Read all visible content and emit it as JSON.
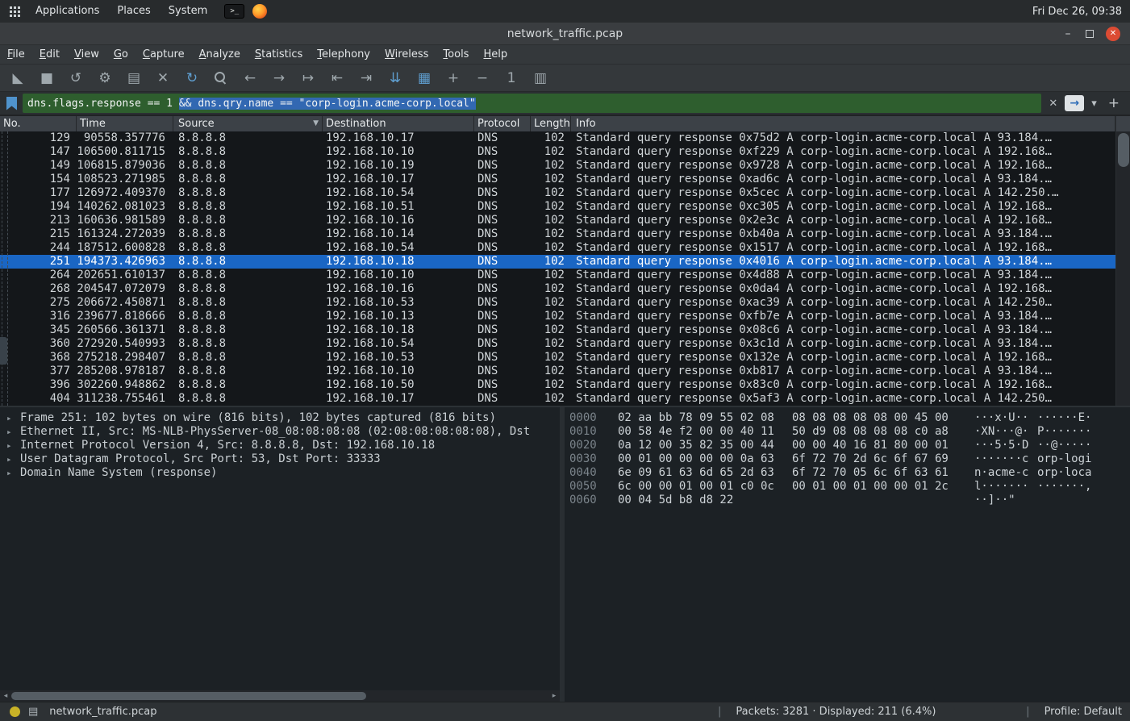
{
  "colors": {
    "filter_valid_bg": "#2e5e2e",
    "text_selection_bg": "#3268b2",
    "selected_row_bg": "#1a66c4",
    "close_button_bg": "#dc4b33",
    "accent_blue": "#5f9ecf",
    "status_dot_yellow": "#c8b227"
  },
  "desktop_bar": {
    "menus": [
      "Applications",
      "Places",
      "System"
    ],
    "terminal_glyph": ">_",
    "clock": "Fri Dec 26, 09:38"
  },
  "window": {
    "title": "network_traffic.pcap",
    "minimize_glyph": "–",
    "close_glyph": "✕"
  },
  "menu_bar": [
    "File",
    "Edit",
    "View",
    "Go",
    "Capture",
    "Analyze",
    "Statistics",
    "Telephony",
    "Wireless",
    "Tools",
    "Help"
  ],
  "toolbar": [
    {
      "name": "start-capture-icon",
      "glyph": "◣",
      "accent": false
    },
    {
      "name": "stop-capture-icon",
      "glyph": "■",
      "accent": false
    },
    {
      "name": "restart-capture-icon",
      "glyph": "↺",
      "accent": false
    },
    {
      "name": "capture-options-icon",
      "glyph": "⚙",
      "accent": false
    },
    {
      "name": "open-file-icon",
      "glyph": "▤",
      "accent": false
    },
    {
      "name": "close-file-icon",
      "glyph": "✕",
      "accent": false
    },
    {
      "name": "reload-icon",
      "glyph": "↻",
      "accent": true
    },
    {
      "name": "find-packet-icon",
      "glyph": "",
      "accent": false
    },
    {
      "name": "go-back-icon",
      "glyph": "←",
      "accent": false
    },
    {
      "name": "go-forward-icon",
      "glyph": "→",
      "accent": false
    },
    {
      "name": "go-to-packet-icon",
      "glyph": "↦",
      "accent": false
    },
    {
      "name": "go-first-icon",
      "glyph": "⇤",
      "accent": false
    },
    {
      "name": "go-last-icon",
      "glyph": "⇥",
      "accent": false
    },
    {
      "name": "auto-scroll-icon",
      "glyph": "⇊",
      "accent": true
    },
    {
      "name": "colorize-icon",
      "glyph": "▦",
      "accent": true
    },
    {
      "name": "zoom-in-icon",
      "glyph": "+",
      "accent": false
    },
    {
      "name": "zoom-out-icon",
      "glyph": "−",
      "accent": false
    },
    {
      "name": "zoom-100-icon",
      "glyph": "1",
      "accent": false
    },
    {
      "name": "resize-columns-icon",
      "glyph": "▥",
      "accent": false
    }
  ],
  "filter_bar": {
    "text_plain": "dns.flags.response == 1 ",
    "text_selected": "&& dns.qry.name == \"corp-login.acme-corp.local\"",
    "clear_glyph": "✕",
    "apply_glyph": "→",
    "dropdown_glyph": "▾",
    "add_glyph": "+"
  },
  "packet_list": {
    "columns": [
      "No.",
      "Time",
      "Source",
      "Destination",
      "Protocol",
      "Length",
      "Info"
    ],
    "column_dropdown_glyph": "▼",
    "selected_no": "251",
    "rows": [
      {
        "no": "129",
        "time": "90558.357776",
        "source": "8.8.8.8",
        "destination": "192.168.10.17",
        "protocol": "DNS",
        "length": "102",
        "info": "Standard query response 0x75d2 A corp-login.acme-corp.local A 93.184.…"
      },
      {
        "no": "147",
        "time": "106500.811715",
        "source": "8.8.8.8",
        "destination": "192.168.10.10",
        "protocol": "DNS",
        "length": "102",
        "info": "Standard query response 0xf229 A corp-login.acme-corp.local A 192.168…"
      },
      {
        "no": "149",
        "time": "106815.879036",
        "source": "8.8.8.8",
        "destination": "192.168.10.19",
        "protocol": "DNS",
        "length": "102",
        "info": "Standard query response 0x9728 A corp-login.acme-corp.local A 192.168…"
      },
      {
        "no": "154",
        "time": "108523.271985",
        "source": "8.8.8.8",
        "destination": "192.168.10.17",
        "protocol": "DNS",
        "length": "102",
        "info": "Standard query response 0xad6c A corp-login.acme-corp.local A 93.184.…"
      },
      {
        "no": "177",
        "time": "126972.409370",
        "source": "8.8.8.8",
        "destination": "192.168.10.54",
        "protocol": "DNS",
        "length": "102",
        "info": "Standard query response 0x5cec A corp-login.acme-corp.local A 142.250.…"
      },
      {
        "no": "194",
        "time": "140262.081023",
        "source": "8.8.8.8",
        "destination": "192.168.10.51",
        "protocol": "DNS",
        "length": "102",
        "info": "Standard query response 0xc305 A corp-login.acme-corp.local A 192.168…"
      },
      {
        "no": "213",
        "time": "160636.981589",
        "source": "8.8.8.8",
        "destination": "192.168.10.16",
        "protocol": "DNS",
        "length": "102",
        "info": "Standard query response 0x2e3c A corp-login.acme-corp.local A 192.168…"
      },
      {
        "no": "215",
        "time": "161324.272039",
        "source": "8.8.8.8",
        "destination": "192.168.10.14",
        "protocol": "DNS",
        "length": "102",
        "info": "Standard query response 0xb40a A corp-login.acme-corp.local A 93.184.…"
      },
      {
        "no": "244",
        "time": "187512.600828",
        "source": "8.8.8.8",
        "destination": "192.168.10.54",
        "protocol": "DNS",
        "length": "102",
        "info": "Standard query response 0x1517 A corp-login.acme-corp.local A 192.168…"
      },
      {
        "no": "251",
        "time": "194373.426963",
        "source": "8.8.8.8",
        "destination": "192.168.10.18",
        "protocol": "DNS",
        "length": "102",
        "info": "Standard query response 0x4016 A corp-login.acme-corp.local A 93.184.…"
      },
      {
        "no": "264",
        "time": "202651.610137",
        "source": "8.8.8.8",
        "destination": "192.168.10.10",
        "protocol": "DNS",
        "length": "102",
        "info": "Standard query response 0x4d88 A corp-login.acme-corp.local A 93.184.…"
      },
      {
        "no": "268",
        "time": "204547.072079",
        "source": "8.8.8.8",
        "destination": "192.168.10.16",
        "protocol": "DNS",
        "length": "102",
        "info": "Standard query response 0x0da4 A corp-login.acme-corp.local A 192.168…"
      },
      {
        "no": "275",
        "time": "206672.450871",
        "source": "8.8.8.8",
        "destination": "192.168.10.53",
        "protocol": "DNS",
        "length": "102",
        "info": "Standard query response 0xac39 A corp-login.acme-corp.local A 142.250…"
      },
      {
        "no": "316",
        "time": "239677.818666",
        "source": "8.8.8.8",
        "destination": "192.168.10.13",
        "protocol": "DNS",
        "length": "102",
        "info": "Standard query response 0xfb7e A corp-login.acme-corp.local A 93.184.…"
      },
      {
        "no": "345",
        "time": "260566.361371",
        "source": "8.8.8.8",
        "destination": "192.168.10.18",
        "protocol": "DNS",
        "length": "102",
        "info": "Standard query response 0x08c6 A corp-login.acme-corp.local A 93.184.…"
      },
      {
        "no": "360",
        "time": "272920.540993",
        "source": "8.8.8.8",
        "destination": "192.168.10.54",
        "protocol": "DNS",
        "length": "102",
        "info": "Standard query response 0x3c1d A corp-login.acme-corp.local A 93.184.…"
      },
      {
        "no": "368",
        "time": "275218.298407",
        "source": "8.8.8.8",
        "destination": "192.168.10.53",
        "protocol": "DNS",
        "length": "102",
        "info": "Standard query response 0x132e A corp-login.acme-corp.local A 192.168…"
      },
      {
        "no": "377",
        "time": "285208.978187",
        "source": "8.8.8.8",
        "destination": "192.168.10.10",
        "protocol": "DNS",
        "length": "102",
        "info": "Standard query response 0xb817 A corp-login.acme-corp.local A 93.184.…"
      },
      {
        "no": "396",
        "time": "302260.948862",
        "source": "8.8.8.8",
        "destination": "192.168.10.50",
        "protocol": "DNS",
        "length": "102",
        "info": "Standard query response 0x83c0 A corp-login.acme-corp.local A 192.168…"
      },
      {
        "no": "404",
        "time": "311238.755461",
        "source": "8.8.8.8",
        "destination": "192.168.10.17",
        "protocol": "DNS",
        "length": "102",
        "info": "Standard query response 0x5af3 A corp-login.acme-corp.local A 142.250…"
      }
    ]
  },
  "details": {
    "expander_glyph": "▸",
    "lines": [
      "Frame 251: 102 bytes on wire (816 bits), 102 bytes captured (816 bits)",
      "Ethernet II, Src: MS-NLB-PhysServer-08_08:08:08:08 (02:08:08:08:08:08), Dst",
      "Internet Protocol Version 4, Src: 8.8.8.8, Dst: 192.168.10.18",
      "User Datagram Protocol, Src Port: 53, Dst Port: 33333",
      "Domain Name System (response)"
    ]
  },
  "hex_dump": {
    "rows": [
      {
        "offset": "0000",
        "hex1": "02 aa bb 78 09 55 02 08",
        "hex2": "08 08 08 08 08 00 45 00",
        "ascii1": "···x·U··",
        "ascii2": "······E·"
      },
      {
        "offset": "0010",
        "hex1": "00 58 4e f2 00 00 40 11",
        "hex2": "50 d9 08 08 08 08 c0 a8",
        "ascii1": "·XN···@·",
        "ascii2": "P·······"
      },
      {
        "offset": "0020",
        "hex1": "0a 12 00 35 82 35 00 44",
        "hex2": "00 00 40 16 81 80 00 01",
        "ascii1": "···5·5·D",
        "ascii2": "··@·····"
      },
      {
        "offset": "0030",
        "hex1": "00 01 00 00 00 00 0a 63",
        "hex2": "6f 72 70 2d 6c 6f 67 69",
        "ascii1": "·······c",
        "ascii2": "orp-logi"
      },
      {
        "offset": "0040",
        "hex1": "6e 09 61 63 6d 65 2d 63",
        "hex2": "6f 72 70 05 6c 6f 63 61",
        "ascii1": "n·acme-c",
        "ascii2": "orp·loca"
      },
      {
        "offset": "0050",
        "hex1": "6c 00 00 01 00 01 c0 0c",
        "hex2": "00 01 00 01 00 00 01 2c",
        "ascii1": "l·······",
        "ascii2": "·······,"
      },
      {
        "offset": "0060",
        "hex1": "00 04 5d b8 d8 22",
        "hex2": "",
        "ascii1": "··]··\"",
        "ascii2": ""
      }
    ]
  },
  "status_bar": {
    "doc_glyph": "▤",
    "filename": "network_traffic.pcap",
    "separator": "|",
    "packets_summary": "Packets: 3281 · Displayed: 211 (6.4%)",
    "profile": "Profile: Default"
  },
  "scrollbar_glyphs": {
    "left": "◂",
    "right": "▸"
  }
}
